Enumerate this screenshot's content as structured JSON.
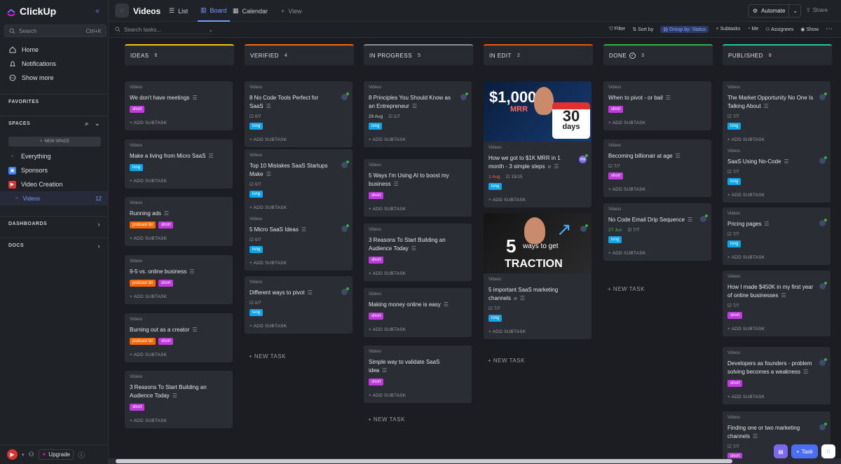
{
  "sidebar": {
    "brand": "ClickUp",
    "search_label": "Search",
    "search_kbd": "Ctrl+K",
    "nav": [
      {
        "label": "Home",
        "icon": "home-icon"
      },
      {
        "label": "Notifications",
        "icon": "bell-icon"
      },
      {
        "label": "Show more",
        "icon": "more-icon"
      }
    ],
    "favorites": "FAVORITES",
    "spaces": "SPACES",
    "new_space": "NEW SPACE",
    "space_items": [
      {
        "label": "Everything"
      },
      {
        "label": "Sponsors",
        "color": "#3b82f6"
      },
      {
        "label": "Video Creation",
        "color": "#e03131"
      },
      {
        "label": "Videos",
        "count": "12"
      }
    ],
    "dashboards": "DASHBOARDS",
    "docs": "DOCS",
    "upgrade": "Upgrade"
  },
  "topbar": {
    "title": "Videos",
    "tabs": [
      "List",
      "Board",
      "Calendar"
    ],
    "add_view": "View",
    "automate": "Automate",
    "share": "Share"
  },
  "filterbar": {
    "search_placeholder": "Search tasks...",
    "options": [
      "Filter",
      "Sort by",
      "Group by: Status",
      "Subtasks",
      "Me",
      "Assignees",
      "Show"
    ]
  },
  "board": {
    "location_label": "Videos",
    "add_subtask": "+ ADD SUBTASK",
    "new_task": "+ NEW TASK",
    "columns": [
      {
        "name": "IDEAS",
        "count": "6",
        "color": "#f5c518",
        "cards": [
          {
            "title": "We don't have meetings",
            "tags": [
              "short"
            ]
          },
          {
            "title": "Make a living from Micro SaaS",
            "tags": [
              "long"
            ]
          },
          {
            "title": "Running ads",
            "tags": [
              "podcast bit",
              "short"
            ]
          },
          {
            "title": "9-5 vs. online business",
            "tags": [
              "podcast bit",
              "short"
            ]
          },
          {
            "title": "Burning out as a creator",
            "tags": [
              "podcast bit",
              "short"
            ]
          },
          {
            "title": "3 Reasons To Start Building an Audience Today",
            "tags": [
              "short"
            ]
          }
        ]
      },
      {
        "name": "VERIFIED",
        "count": "4",
        "color": "#f76707",
        "cards": [
          {
            "title": "8 No Code Tools Perfect for SaaS",
            "check": "0/7",
            "tags": [
              "long"
            ]
          },
          {
            "title": "Top 10 Mistakes SaaS Startups Make",
            "check": "0/7",
            "tags": [
              "long"
            ]
          },
          {
            "title": "5 Micro SaaS Ideas",
            "check": "0/7",
            "tags": [
              "long"
            ]
          },
          {
            "title": "Different ways to pivot",
            "check": "0/7",
            "tags": [
              "long"
            ]
          }
        ]
      },
      {
        "name": "IN PROGRESS",
        "count": "5",
        "color": "#868e96",
        "cards": [
          {
            "title": "8 Principles You Should Know as an Entrepreneur",
            "date": "29 Aug",
            "check": "1/7",
            "tags": [
              "long"
            ]
          },
          {
            "title": "5 Ways I'm Using AI to boost my business",
            "tags": [
              "short"
            ]
          },
          {
            "title": "3 Reasons To Start Building an Audience Today",
            "tags": [
              "short"
            ]
          },
          {
            "title": "Making money online is easy",
            "tags": [
              "short"
            ]
          },
          {
            "title": "Simple way to validate SaaS idea",
            "tags": [
              "short"
            ]
          }
        ]
      },
      {
        "name": "IN EDIT",
        "count": "2",
        "color": "#e8590c",
        "cards": [
          {
            "title": "How we got to $1K MRR in 1 month - 3 simple steps",
            "date": "1 Aug",
            "check": "15/15",
            "tags": [
              "long"
            ],
            "assignee": "HM",
            "thumb": {
              "big": "$1,000",
              "sub": "MRR",
              "badge1": "30",
              "badge2": "days"
            }
          },
          {
            "title": "5 important SaaS marketing channels",
            "check": "7/7",
            "tags": [
              "long"
            ],
            "thumb": {
              "big": "5",
              "line1": "ways to get",
              "line2": "TRACTION"
            }
          }
        ]
      },
      {
        "name": "DONE",
        "count": "3",
        "color": "#2fb344",
        "cards": [
          {
            "title": "When to pivot - or bail",
            "tags": [
              "short"
            ]
          },
          {
            "title": "Becoming billionair at age",
            "check": "7/7",
            "tags": [
              "short"
            ]
          },
          {
            "title": "No Code Email Drip Sequence",
            "date": "27 Jun",
            "check": "7/7",
            "tags": [
              "long"
            ]
          }
        ]
      },
      {
        "name": "PUBLISHED",
        "count": "8",
        "color": "#20c997",
        "cards": [
          {
            "title": "The Market Opportunity No One Is Talking About",
            "check": "7/7",
            "tags": [
              "long"
            ]
          },
          {
            "title": "SaaS Using No-Code",
            "check": "7/7",
            "tags": [
              "long"
            ]
          },
          {
            "title": "Pricing pages",
            "check": "7/7",
            "tags": [
              "long"
            ]
          },
          {
            "title": "How I made $450K in my first year of online businesses",
            "check": "7/7",
            "tags": [
              "short"
            ]
          },
          {
            "title": "Developers as founders - problem solving becomes a weakness",
            "tags": [
              "short"
            ]
          },
          {
            "title": "Finding one or two marketing channels",
            "check": "7/7",
            "tags": [
              "short"
            ]
          }
        ]
      }
    ]
  },
  "fab": {
    "task": "Task"
  }
}
